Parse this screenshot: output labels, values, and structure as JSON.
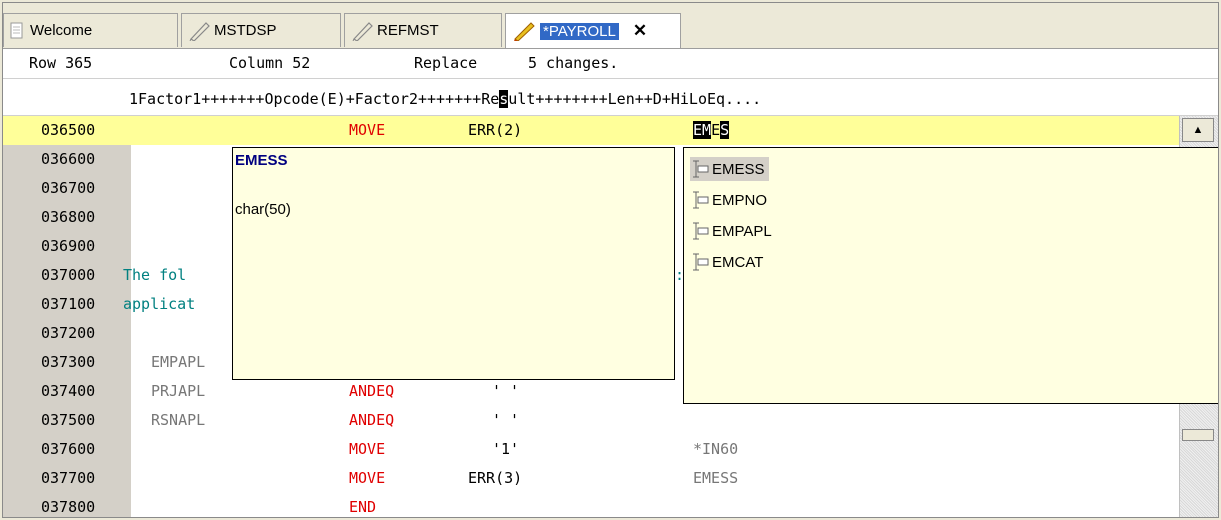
{
  "tabs": [
    {
      "label": "Welcome",
      "icon": "welcome-icon"
    },
    {
      "label": "MSTDSP",
      "icon": "pencil-icon"
    },
    {
      "label": "REFMST",
      "icon": "pencil-icon"
    },
    {
      "label": "*PAYROLL",
      "icon": "pencil-icon",
      "active": true
    }
  ],
  "status": {
    "row": "Row 365",
    "column": "Column 52",
    "mode": "Replace",
    "changes": "5 changes."
  },
  "ruler": {
    "pre": "1Factor1+++++++Opcode(E)+Factor2+++++++Re",
    "cursor": "s",
    "post": "ult++++++++Len++D+HiLoEq...."
  },
  "lines": [
    {
      "num": "036500",
      "f1": "",
      "op": "MOVE",
      "f2": "ERR(2)",
      "res": ""
    },
    {
      "num": "036600",
      "f1": "",
      "op": "",
      "f2": "",
      "res": ""
    },
    {
      "num": "036700",
      "f1": "",
      "op": "",
      "f2": "",
      "res": ""
    },
    {
      "num": "036800",
      "f1": "",
      "op": "",
      "f2": "",
      "res": ""
    },
    {
      "num": "036900",
      "f1": "",
      "op": "",
      "f2": "",
      "res": ""
    },
    {
      "num": "037000",
      "comment": "The fol",
      "comment_tail": ":"
    },
    {
      "num": "037100",
      "comment": "applicat"
    },
    {
      "num": "037200",
      "f1": "",
      "op": "",
      "f2": "",
      "res": ""
    },
    {
      "num": "037300",
      "f1": "EMPAPL",
      "op": "",
      "f2": "",
      "res": ""
    },
    {
      "num": "037400",
      "f1": "PRJAPL",
      "op": "ANDEQ",
      "f2": "' '",
      "res": ""
    },
    {
      "num": "037500",
      "f1": "RSNAPL",
      "op": "ANDEQ",
      "f2": "' '",
      "res": ""
    },
    {
      "num": "037600",
      "f1": "",
      "op": "MOVE",
      "f2": "'1'",
      "res": "*IN60"
    },
    {
      "num": "037700",
      "f1": "",
      "op": "MOVE",
      "f2": "ERR(3)",
      "res": "EMESS"
    },
    {
      "num": "037800",
      "f1": "",
      "op": "END",
      "f2": "",
      "res": ""
    }
  ],
  "current_result": {
    "a": "EM",
    "b": "E",
    "c": "S"
  },
  "info_popup": {
    "title": "EMESS",
    "detail": "char(50)"
  },
  "assist_items": [
    "EMESS",
    "EMPNO",
    "EMPAPL",
    "EMCAT"
  ],
  "colors": {
    "accent": "#3169c6",
    "current_line": "#ffff99",
    "keyword": "#e00000",
    "comment": "#008080",
    "popup_bg": "#ffffe1"
  }
}
